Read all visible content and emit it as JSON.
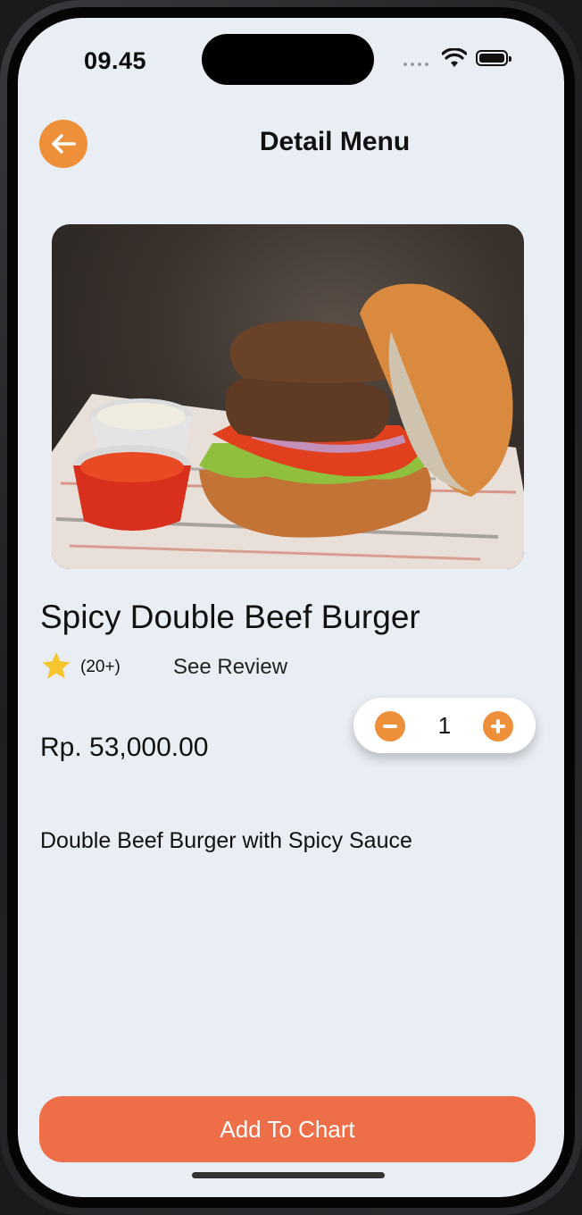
{
  "status_bar": {
    "time": "09.45",
    "wifi_icon": "wifi-icon",
    "battery_icon": "battery-full-icon"
  },
  "header": {
    "back_icon": "arrow-left-icon",
    "title": "Detail Menu"
  },
  "product": {
    "image": "burger-photo",
    "name": "Spicy Double Beef Burger",
    "rating_icon": "star-icon",
    "review_count": "(20+)",
    "see_review_label": "See Review",
    "price": "Rp. 53,000.00",
    "quantity": "1",
    "description": "Double Beef Burger with Spicy Sauce"
  },
  "actions": {
    "add_label": "Add To Chart"
  },
  "colors": {
    "accent": "#ee8f3a",
    "primary_button": "#ee6f47",
    "screen_background": "#e9eef4",
    "star": "#f7c62f"
  }
}
